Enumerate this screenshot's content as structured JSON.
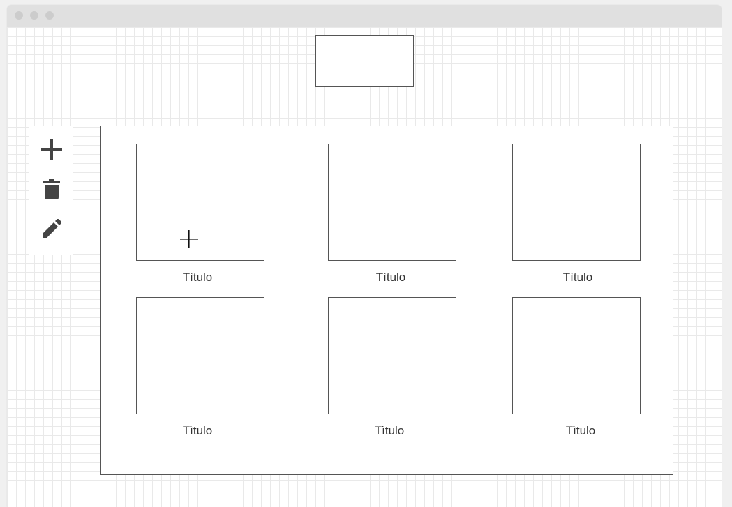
{
  "window": {
    "titlebar_dots": [
      "close-dot",
      "minimize-dot",
      "maximize-dot"
    ]
  },
  "toolbar": {
    "tools": [
      {
        "name": "add",
        "icon": "plus-icon"
      },
      {
        "name": "delete",
        "icon": "trash-icon"
      },
      {
        "name": "edit",
        "icon": "pencil-icon"
      }
    ]
  },
  "gallery": {
    "items": [
      {
        "title": "Tìtulo"
      },
      {
        "title": "Tìtulo"
      },
      {
        "title": "Tìtulo"
      },
      {
        "title": "Tìtulo"
      },
      {
        "title": "Tìtulo"
      },
      {
        "title": "Tìtulo"
      }
    ]
  },
  "colors": {
    "border": "#555555",
    "icon": "#444444",
    "grid": "#e9e9e9",
    "titlebar": "#e0e0e0",
    "dot": "#cccccc"
  }
}
